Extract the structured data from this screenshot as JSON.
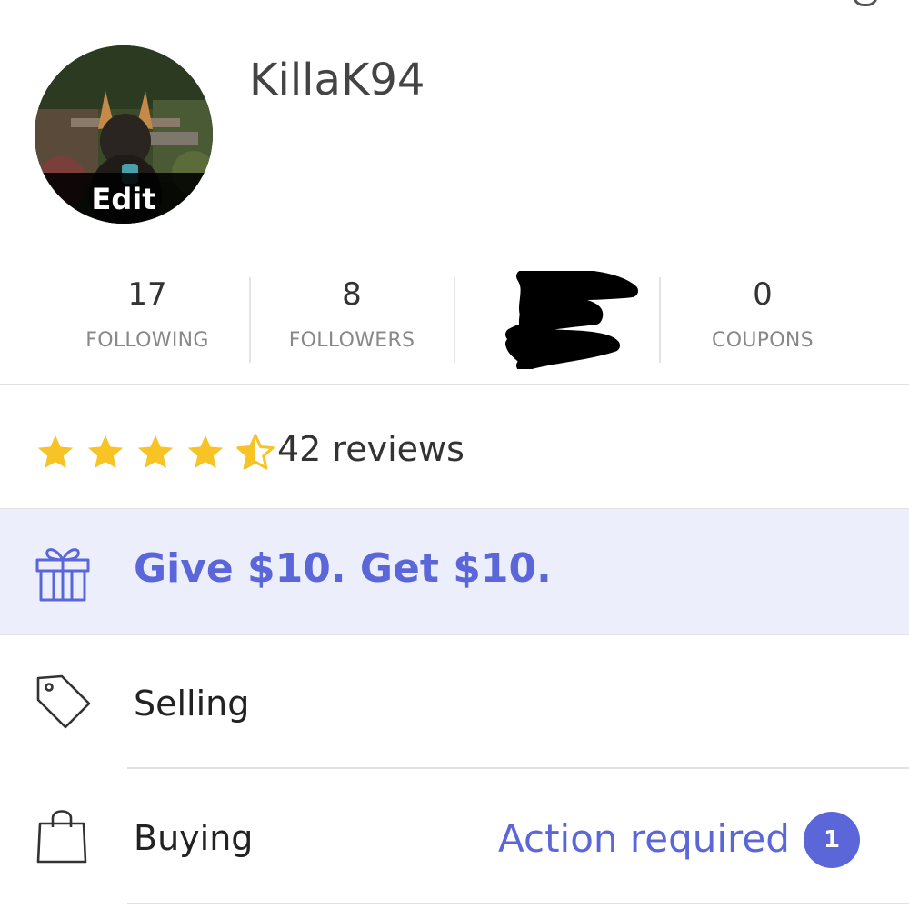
{
  "profile": {
    "username": "KillaK94",
    "edit_label": "Edit"
  },
  "stats": [
    {
      "value": "17",
      "label": "FOLLOWING"
    },
    {
      "value": "8",
      "label": "FOLLOWERS"
    },
    {
      "value": "",
      "label": ""
    },
    {
      "value": "0",
      "label": "COUPONS"
    }
  ],
  "reviews": {
    "rating": 4.5,
    "text": "42 reviews",
    "star_color": "#f7c325"
  },
  "promo": {
    "text": "Give $10. Get $10.",
    "icon": "gift-icon",
    "accent": "#5b67d8"
  },
  "menu": {
    "selling": {
      "label": "Selling",
      "icon": "tag-icon"
    },
    "buying": {
      "label": "Buying",
      "icon": "shopping-bag-icon",
      "status": "Action required",
      "badge": "1"
    }
  }
}
